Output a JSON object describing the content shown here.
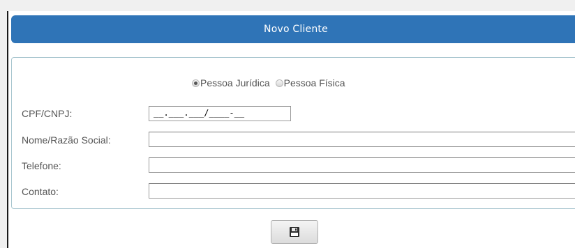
{
  "header": {
    "title": "Novo Cliente"
  },
  "person_type": {
    "options": [
      {
        "label": "Pessoa Jurídica",
        "selected": true
      },
      {
        "label": "Pessoa Física",
        "selected": false
      }
    ]
  },
  "fields": {
    "cpf_cnpj": {
      "label": "CPF/CNPJ:",
      "value": "__.___.___/____-__"
    },
    "nome": {
      "label": "Nome/Razão Social:",
      "value": ""
    },
    "telefone": {
      "label": "Telefone:",
      "value": ""
    },
    "contato": {
      "label": "Contato:",
      "value": ""
    }
  },
  "actions": {
    "save_icon": "floppy-disk-icon"
  },
  "colors": {
    "header_bg": "#2f74b7",
    "form_border": "#a8c6cf"
  }
}
